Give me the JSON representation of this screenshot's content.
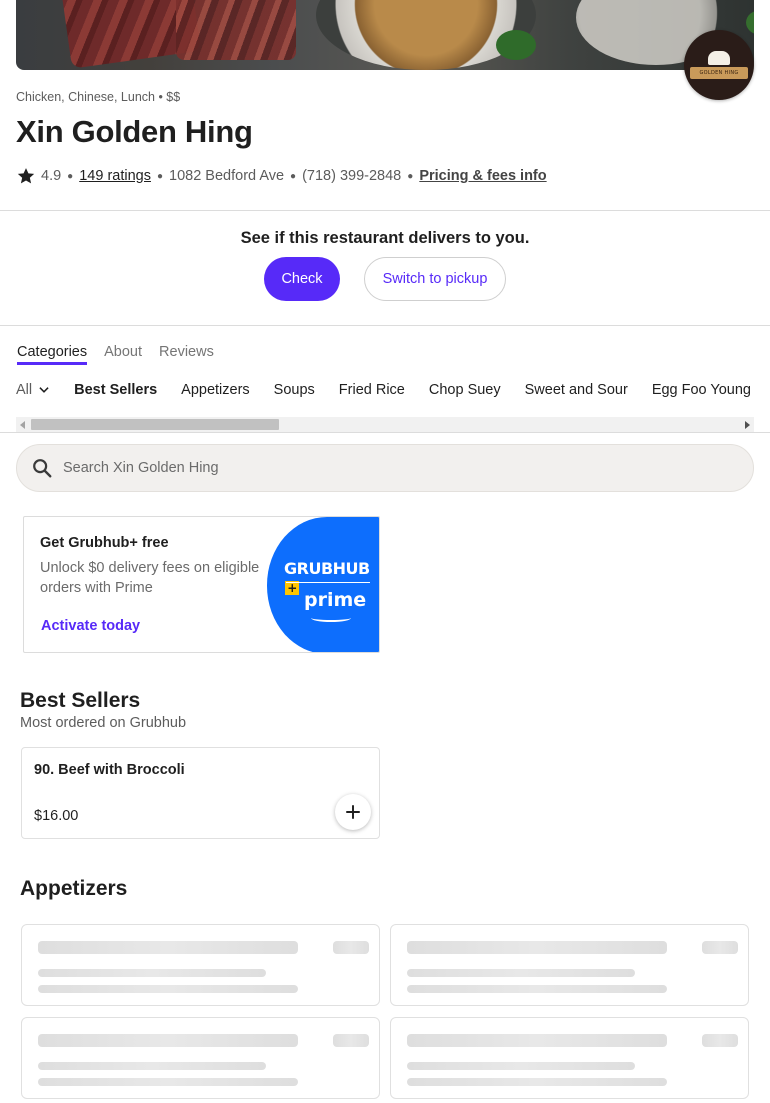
{
  "restaurant": {
    "cuisines": "Chicken, Chinese, Lunch • $$",
    "name": "Xin Golden Hing",
    "logo_text": "GOLDEN HING",
    "rating": "4.9",
    "ratings_count": "149 ratings",
    "address": "1082 Bedford Ave",
    "phone": "(718) 399-2848",
    "fees_link": "Pricing & fees info"
  },
  "delivery": {
    "question": "See if this restaurant delivers to you.",
    "check_label": "Check",
    "pickup_label": "Switch to pickup"
  },
  "tabs": [
    {
      "label": "Categories",
      "active": true
    },
    {
      "label": "About",
      "active": false
    },
    {
      "label": "Reviews",
      "active": false
    }
  ],
  "categories": {
    "all_label": "All",
    "items": [
      "Best Sellers",
      "Appetizers",
      "Soups",
      "Fried Rice",
      "Chop Suey",
      "Sweet and Sour",
      "Egg Foo Young"
    ]
  },
  "search": {
    "placeholder": "Search Xin Golden Hing"
  },
  "promo": {
    "title": "Get Grubhub+ free",
    "description": "Unlock $0 delivery fees on eligible orders with Prime",
    "cta": "Activate today",
    "brand_text": "GRUBHUB",
    "prime_text": "prime"
  },
  "best_sellers": {
    "title": "Best Sellers",
    "subtitle": "Most ordered on Grubhub",
    "items": [
      {
        "name": "90. Beef with Broccoli",
        "price": "$16.00"
      }
    ]
  },
  "appetizers": {
    "title": "Appetizers"
  },
  "colors": {
    "accent": "#572af8",
    "promo_blue": "#0d6efd",
    "grubhub_plus_yellow": "#ffc500"
  }
}
